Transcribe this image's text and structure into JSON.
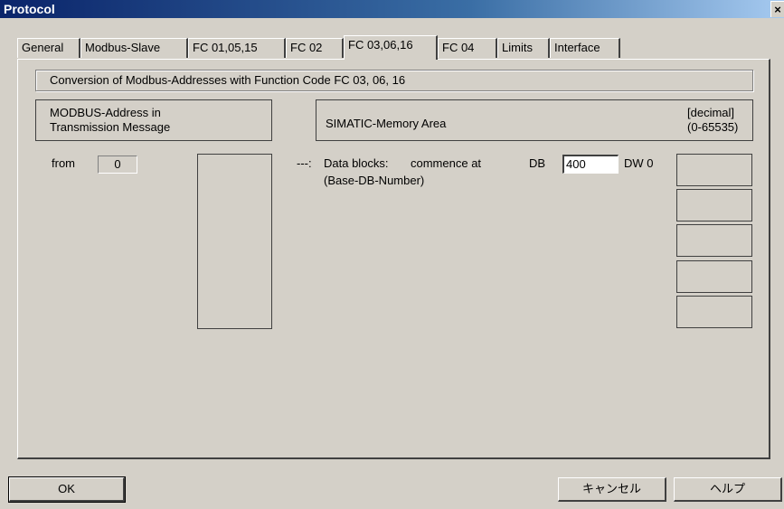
{
  "window": {
    "title": "Protocol",
    "close": "×"
  },
  "tabs": [
    {
      "label": "General"
    },
    {
      "label": "Modbus-Slave"
    },
    {
      "label": "FC 01,05,15"
    },
    {
      "label": "FC 02"
    },
    {
      "label": "FC 03,06,16",
      "active": true
    },
    {
      "label": "FC 04"
    },
    {
      "label": "Limits"
    },
    {
      "label": "Interface"
    }
  ],
  "panel": {
    "heading": "Conversion of  Modbus-Addresses  with  Function Code  FC 03, 06, 16",
    "modbus_header_line1": "MODBUS-Address in",
    "modbus_header_line2": "Transmission Message",
    "simatic_header": "SIMATIC-Memory Area",
    "range_line1": "[decimal]",
    "range_line2": "(0-65535)",
    "from_label": "from",
    "from_value": "0",
    "arrow": "---:",
    "data_blocks_label": "Data blocks:",
    "commence_label": "commence at",
    "db_label": "DB",
    "db_value": "400",
    "dw_label": "DW 0",
    "base_db_label": "(Base-DB-Number)"
  },
  "buttons": {
    "ok": "OK",
    "cancel": "キャンセル",
    "help": "ヘルプ"
  }
}
